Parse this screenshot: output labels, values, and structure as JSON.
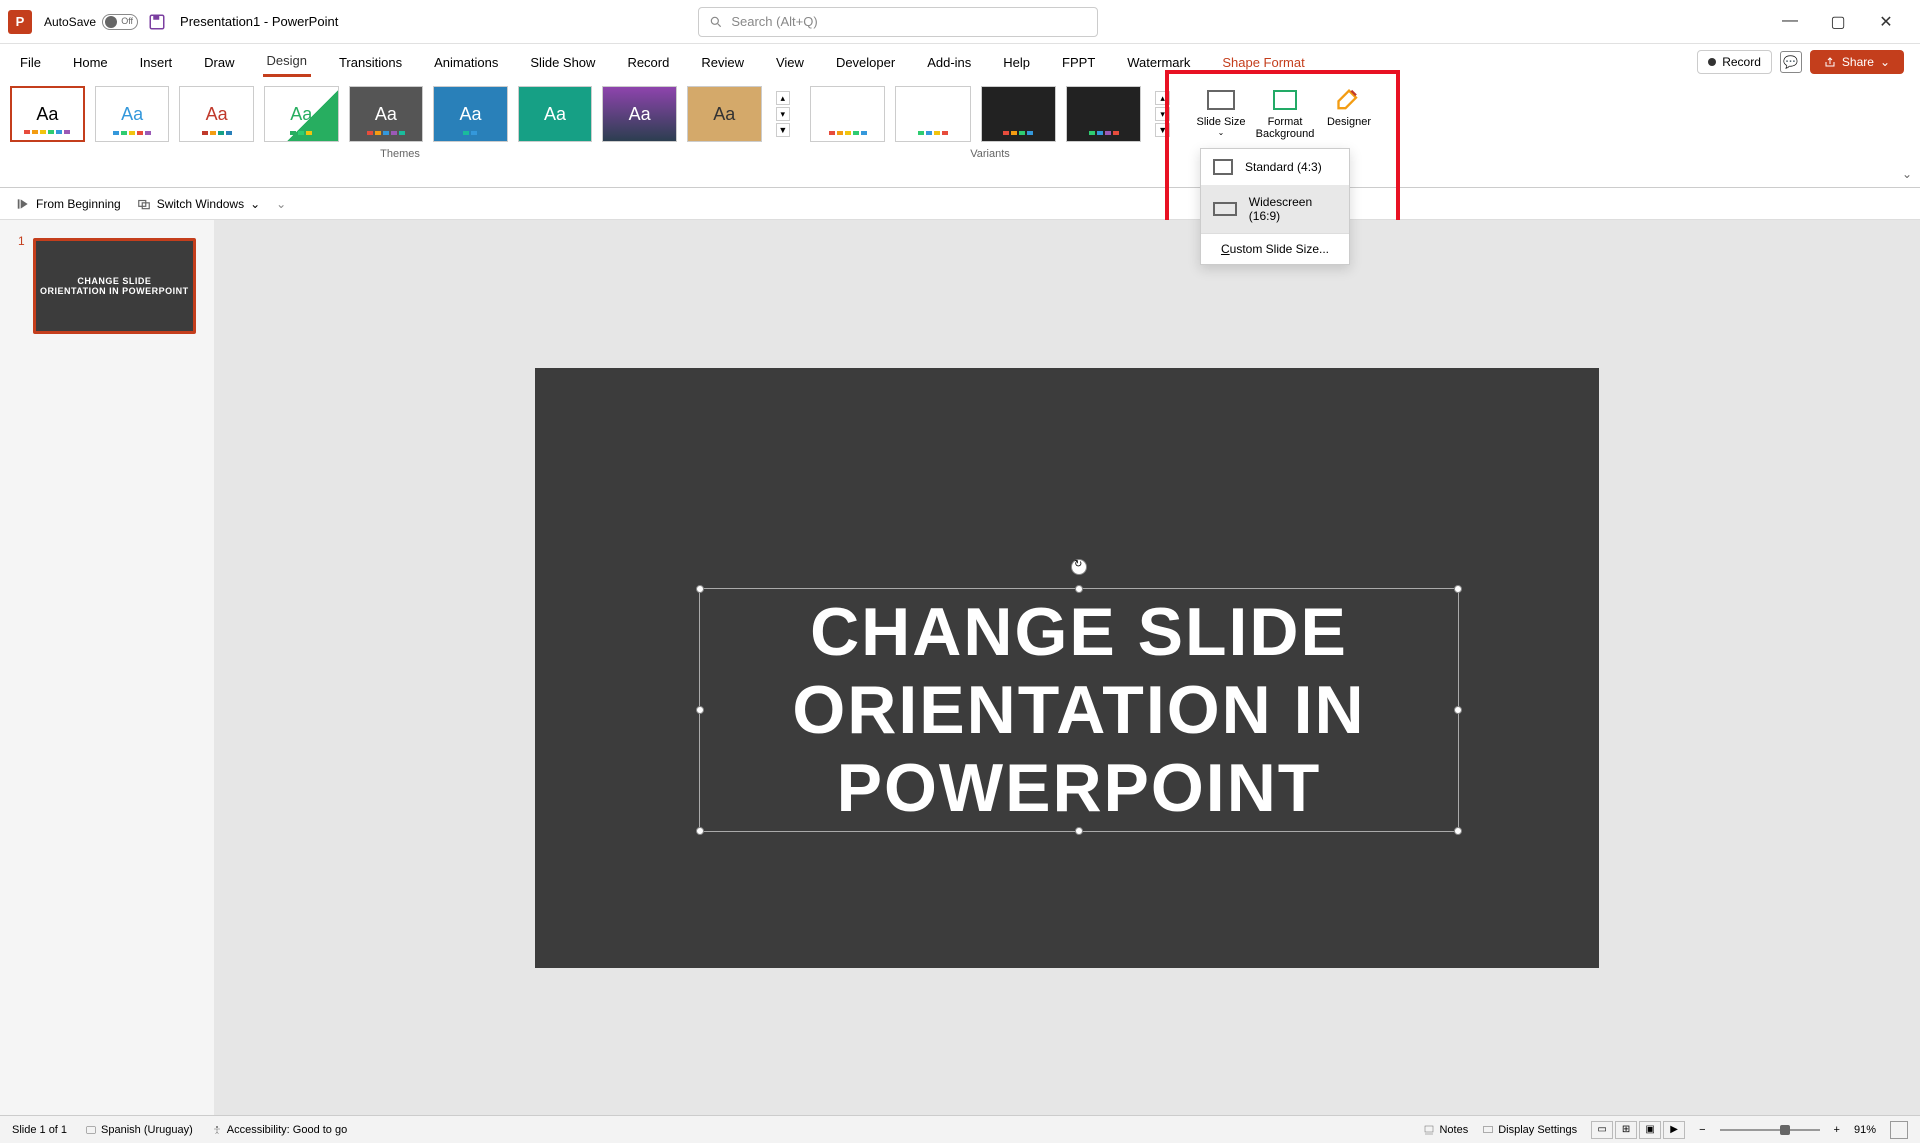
{
  "titlebar": {
    "autosave_label": "AutoSave",
    "autosave_off": "Off",
    "doc_title": "Presentation1 - PowerPoint",
    "search_placeholder": "Search (Alt+Q)"
  },
  "tabs": {
    "file": "File",
    "home": "Home",
    "insert": "Insert",
    "draw": "Draw",
    "design": "Design",
    "transitions": "Transitions",
    "animations": "Animations",
    "slideshow": "Slide Show",
    "record": "Record",
    "review": "Review",
    "view": "View",
    "developer": "Developer",
    "addins": "Add-ins",
    "help": "Help",
    "fppt": "FPPT",
    "watermark": "Watermark",
    "shapeformat": "Shape Format"
  },
  "ribbon_right": {
    "record": "Record",
    "share": "Share"
  },
  "groups": {
    "themes": "Themes",
    "variants": "Variants"
  },
  "customize": {
    "slide_size": "Slide Size",
    "format_bg": "Format Background",
    "designer": "Designer"
  },
  "dropdown": {
    "standard": "Standard (4:3)",
    "widescreen": "Widescreen (16:9)",
    "custom_prefix": "C",
    "custom_rest": "ustom Slide Size..."
  },
  "qat": {
    "from_beginning": "From Beginning",
    "switch_windows": "Switch Windows"
  },
  "slide": {
    "number": "1",
    "title_line1": "CHANGE SLIDE",
    "title_line2": "ORIENTATION IN POWERPOINT"
  },
  "statusbar": {
    "slide_count": "Slide 1 of 1",
    "language": "Spanish (Uruguay)",
    "accessibility": "Accessibility: Good to go",
    "notes": "Notes",
    "display_settings": "Display Settings",
    "zoom": "91%"
  },
  "theme_thumbs": [
    "Aa",
    "Aa",
    "Aa",
    "Aa",
    "Aa",
    "Aa",
    "Aa",
    "Aa"
  ]
}
